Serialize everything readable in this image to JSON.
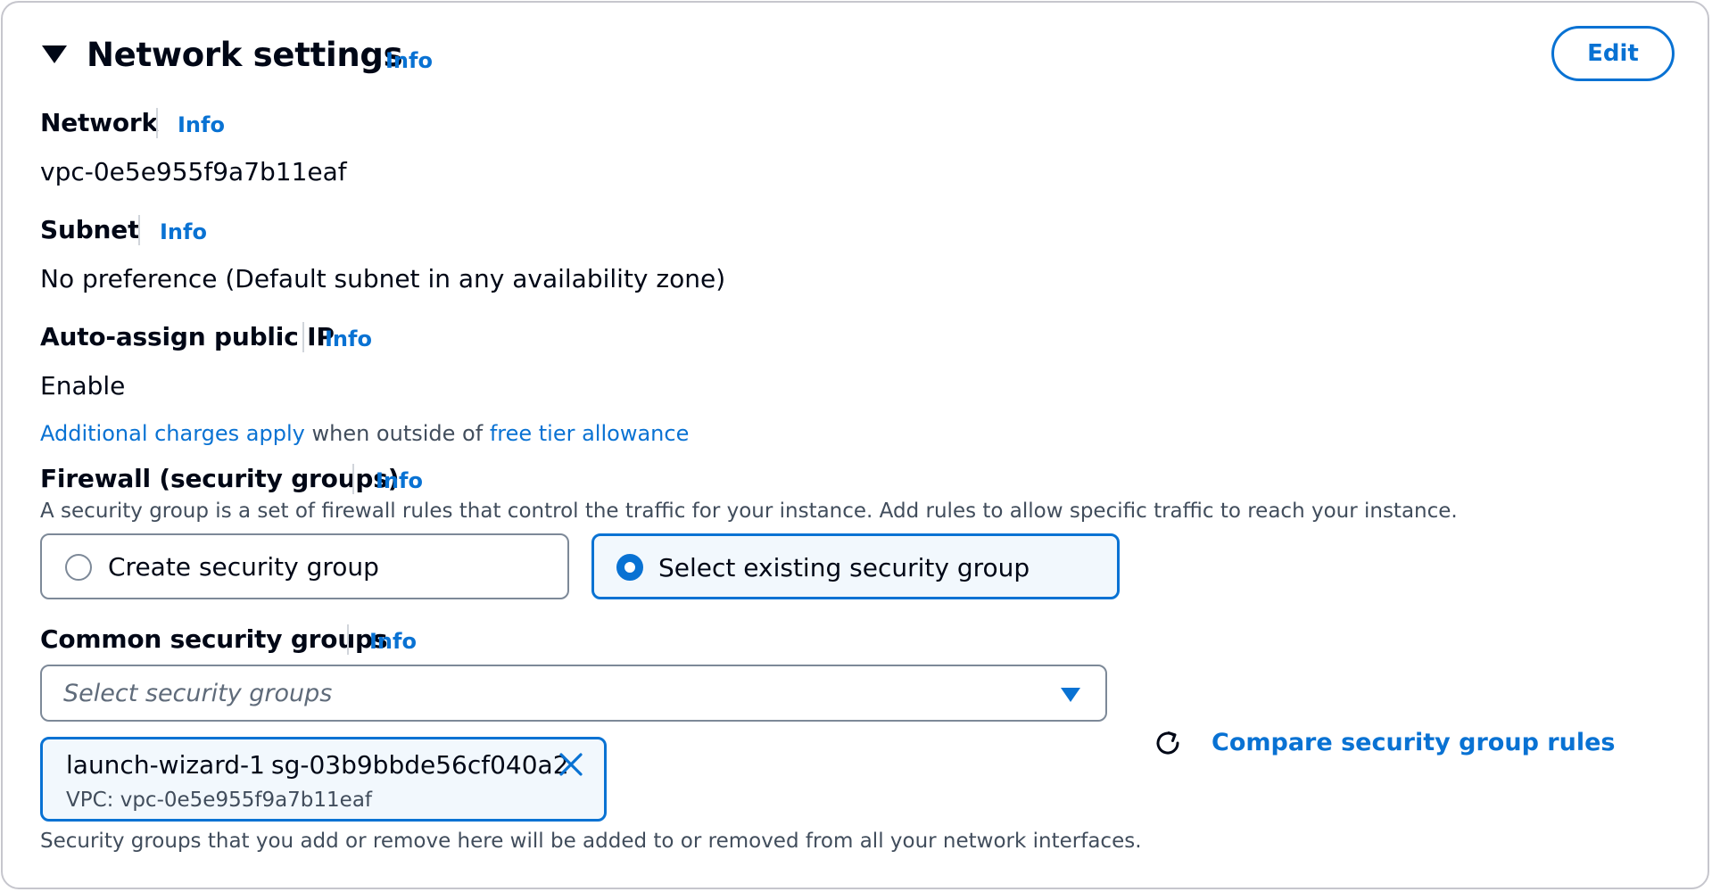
{
  "header": {
    "title": "Network settings",
    "info": "Info",
    "edit_label": "Edit"
  },
  "network": {
    "label": "Network",
    "info": "Info",
    "value": "vpc-0e5e955f9a7b11eaf"
  },
  "subnet": {
    "label": "Subnet",
    "info": "Info",
    "value": "No preference (Default subnet in any availability zone)"
  },
  "public_ip": {
    "label": "Auto-assign public IP",
    "info": "Info",
    "value": "Enable",
    "note_link1": "Additional charges apply",
    "note_text": " when outside of ",
    "note_link2": "free tier allowance"
  },
  "firewall": {
    "label": "Firewall (security groups)",
    "info": "Info",
    "description": "A security group is a set of firewall rules that control the traffic for your instance. Add rules to allow specific traffic to reach your instance.",
    "options": [
      {
        "label": "Create security group",
        "selected": false
      },
      {
        "label": "Select existing security group",
        "selected": true
      }
    ]
  },
  "common_groups": {
    "label": "Common security groups",
    "info": "Info",
    "placeholder": "Select security groups",
    "token": {
      "name": "launch-wizard-1",
      "id": "sg-03b9bbde56cf040a2",
      "vpc": "VPC: vpc-0e5e955f9a7b11eaf"
    },
    "compare_label": "Compare security group rules",
    "footer": "Security groups that you add or remove here will be added to or removed from all your network interfaces."
  },
  "icons": {
    "collapse": "caret-down-icon",
    "dropdown": "dropdown-arrow-icon",
    "remove": "close-icon",
    "refresh": "refresh-icon"
  },
  "colors": {
    "link": "#0972d3",
    "text": "#000716",
    "secondary_text": "#414d5c",
    "selected_bg": "#f2f8fd",
    "border": "#7d8998"
  }
}
